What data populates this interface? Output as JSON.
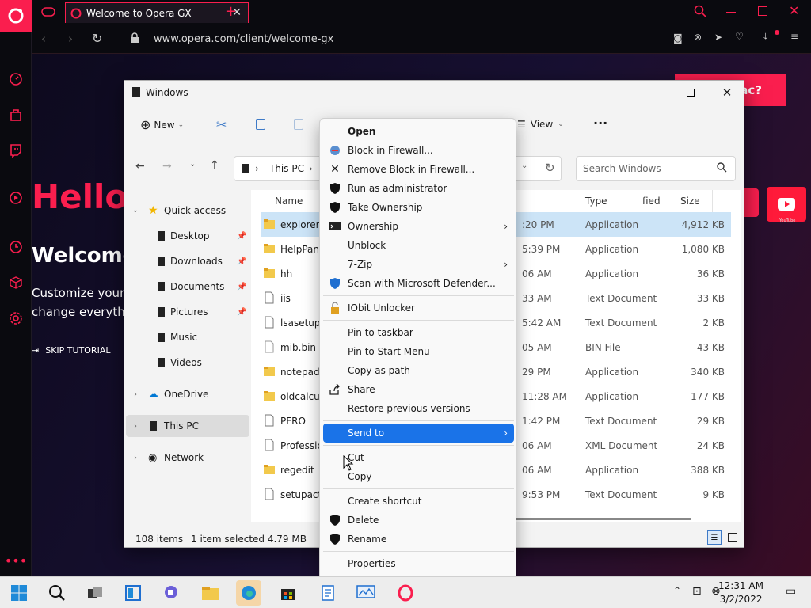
{
  "browser": {
    "tab_title": "Welcome to Opera GX",
    "url": "www.opera.com/client/welcome-gx"
  },
  "welcome_page": {
    "hello": "Hello",
    "welcome": "Welcome",
    "customize_line1": "Customize your",
    "customize_line2": "change everyth",
    "skip": "SKIP TUTORIAL",
    "pink_button": "ac?",
    "yt_label": "YouTube"
  },
  "explorer": {
    "title": "Windows",
    "cmd_new": "New",
    "cmd_view": "View",
    "breadcrumb_this_pc": "This PC",
    "breadcrumb_sep": "›",
    "search_placeholder": "Search Windows",
    "nav": {
      "quick_access": "Quick access",
      "desktop": "Desktop",
      "downloads": "Downloads",
      "documents": "Documents",
      "pictures": "Pictures",
      "music": "Music",
      "videos": "Videos",
      "onedrive": "OneDrive",
      "this_pc": "This PC",
      "network": "Network"
    },
    "columns": {
      "name": "Name",
      "modified": "fied",
      "type": "Type",
      "size": "Size"
    },
    "rows": [
      {
        "name": "explorer",
        "modified": ":20 PM",
        "type": "Application",
        "size": "4,912 KB"
      },
      {
        "name": "HelpPane",
        "modified": "5:39 PM",
        "type": "Application",
        "size": "1,080 KB"
      },
      {
        "name": "hh",
        "modified": "06 AM",
        "type": "Application",
        "size": "36 KB"
      },
      {
        "name": "iis",
        "modified": "33 AM",
        "type": "Text Document",
        "size": "33 KB"
      },
      {
        "name": "lsasetup",
        "modified": "5:42 AM",
        "type": "Text Document",
        "size": "2 KB"
      },
      {
        "name": "mib.bin",
        "modified": "05 AM",
        "type": "BIN File",
        "size": "43 KB"
      },
      {
        "name": "notepad",
        "modified": "29 PM",
        "type": "Application",
        "size": "340 KB"
      },
      {
        "name": "oldcalcu",
        "modified": "11:28 AM",
        "type": "Application",
        "size": "177 KB"
      },
      {
        "name": "PFRO",
        "modified": "1:42 PM",
        "type": "Text Document",
        "size": "29 KB"
      },
      {
        "name": "Professio",
        "modified": "06 AM",
        "type": "XML Document",
        "size": "24 KB"
      },
      {
        "name": "regedit",
        "modified": "06 AM",
        "type": "Application",
        "size": "388 KB"
      },
      {
        "name": "setupact",
        "modified": "9:53 PM",
        "type": "Text Document",
        "size": "9 KB"
      }
    ],
    "status_count": "108 items",
    "status_selected": "1 item selected  4.79 MB"
  },
  "context_menu": {
    "open": "Open",
    "block_fw": "Block in Firewall...",
    "remove_block_fw": "Remove Block in Firewall...",
    "run_admin": "Run as administrator",
    "take_ownership": "Take Ownership",
    "ownership": "Ownership",
    "unblock": "Unblock",
    "sevenzip": "7-Zip",
    "scan_defender": "Scan with Microsoft Defender...",
    "iobit": "IObit Unlocker",
    "pin_taskbar": "Pin to taskbar",
    "pin_start": "Pin to Start Menu",
    "copy_path": "Copy as path",
    "share": "Share",
    "restore_versions": "Restore previous versions",
    "send_to": "Send to",
    "cut": "Cut",
    "copy": "Copy",
    "create_shortcut": "Create shortcut",
    "delete": "Delete",
    "rename": "Rename",
    "properties": "Properties"
  },
  "taskbar": {
    "time": "12:31 AM",
    "date": "3/2/2022"
  },
  "colors": {
    "opera_red": "#fa1e4e",
    "highlight_blue": "#1a73e8",
    "selection_blue": "#cce4f7"
  }
}
